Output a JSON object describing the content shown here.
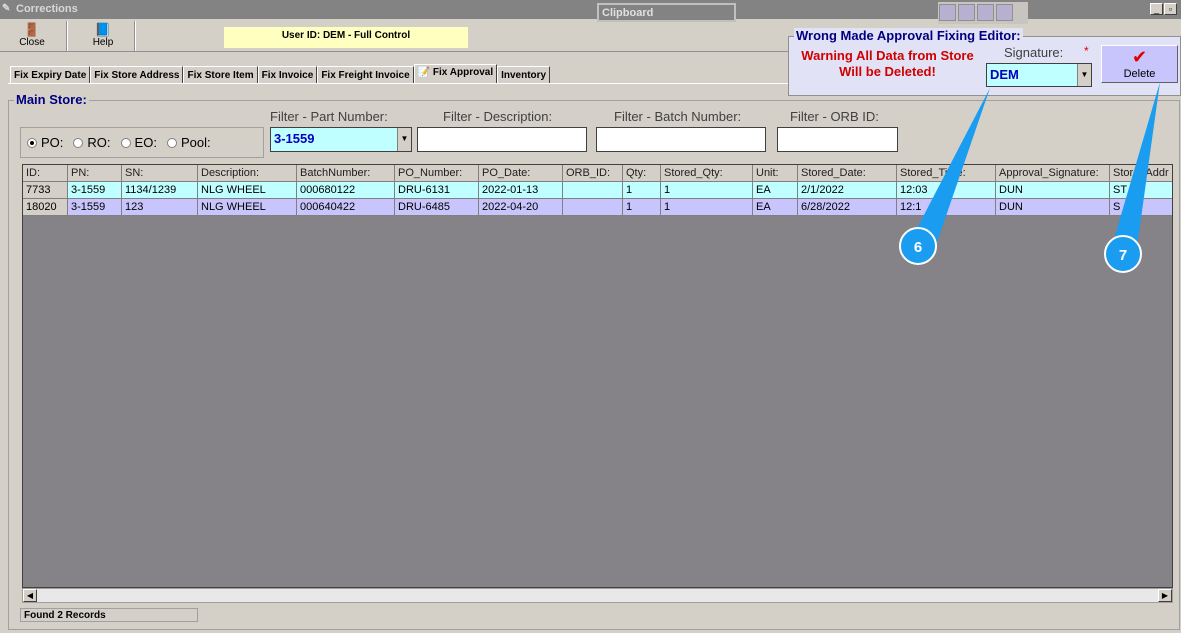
{
  "window": {
    "title": "Corrections",
    "clipboard": "Clipboard",
    "minimize": "_",
    "restore": "▫"
  },
  "toolbar": {
    "close": "Close",
    "help": "Help",
    "user": "User ID: DEM - Full Control"
  },
  "tabs": [
    "Fix Expiry Date",
    "Fix Store Address",
    "Fix Store Item",
    "Fix Invoice",
    "Fix Freight Invoice",
    "Fix Approval",
    "Inventory"
  ],
  "group_label": "Main Store:",
  "radios": [
    {
      "label": "PO:",
      "checked": true
    },
    {
      "label": "RO:",
      "checked": false
    },
    {
      "label": "EO:",
      "checked": false
    },
    {
      "label": "Pool:",
      "checked": false
    }
  ],
  "filters": {
    "part_label": "Filter - Part Number:",
    "part_value": "3-1559",
    "desc_label": "Filter - Description:",
    "desc_value": "",
    "batch_label": "Filter - Batch Number:",
    "batch_value": "",
    "orb_label": "Filter - ORB ID:",
    "orb_value": ""
  },
  "grid": {
    "columns": [
      "ID:",
      "PN:",
      "SN:",
      "Description:",
      "BatchNumber:",
      "PO_Number:",
      "PO_Date:",
      "ORB_ID:",
      "Qty:",
      "Stored_Qty:",
      "Unit:",
      "Stored_Date:",
      "Stored_Time:",
      "Approval_Signature:",
      "Store_Addr"
    ],
    "rows": [
      [
        "7733",
        "3-1559",
        "1134/1239",
        "NLG WHEEL",
        "000680122",
        "DRU-6131",
        "2022-01-13",
        "",
        "1",
        "1",
        "EA",
        "2/1/2022",
        "12:03",
        "DUN",
        "ST"
      ],
      [
        "18020",
        "3-1559",
        "123",
        "NLG WHEEL",
        "000640422",
        "DRU-6485",
        "2022-04-20",
        "",
        "1",
        "1",
        "EA",
        "6/28/2022",
        "12:1",
        "DUN",
        "S"
      ]
    ]
  },
  "status": "Found 2 Records",
  "editor": {
    "title": "Wrong Made Approval Fixing Editor:",
    "warning_line1": "Warning All Data from Store",
    "warning_line2": "Will be Deleted!",
    "signature_label": "Signature:",
    "required": "*",
    "signature_value": "DEM",
    "delete": "Delete"
  },
  "callouts": [
    "6",
    "7"
  ]
}
